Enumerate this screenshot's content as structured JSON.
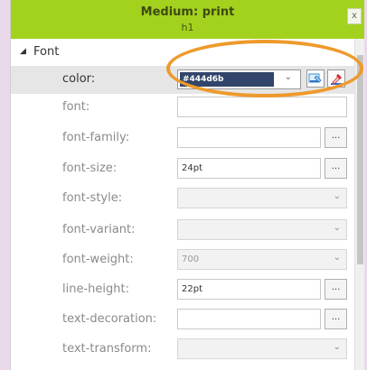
{
  "header": {
    "title": "Medium: print",
    "subtitle": "h1",
    "close_glyph": "x"
  },
  "section": {
    "label": "Font",
    "collapse_icon": "triangle-down-icon"
  },
  "properties": [
    {
      "label": "color:",
      "value": "#444d6b",
      "type": "color"
    },
    {
      "label": "font:",
      "value": "",
      "type": "text"
    },
    {
      "label": "font-family:",
      "value": "",
      "type": "text-ellipsis"
    },
    {
      "label": "font-size:",
      "value": "24pt",
      "type": "text-ellipsis"
    },
    {
      "label": "font-style:",
      "value": "",
      "type": "select"
    },
    {
      "label": "font-variant:",
      "value": "",
      "type": "select"
    },
    {
      "label": "font-weight:",
      "value": "700",
      "type": "select"
    },
    {
      "label": "line-height:",
      "value": "22pt",
      "type": "text-ellipsis"
    },
    {
      "label": "text-decoration:",
      "value": "",
      "type": "text-ellipsis"
    },
    {
      "label": "text-transform:",
      "value": "",
      "type": "select"
    }
  ],
  "ellipsis_label": "...",
  "chevron_glyph": "⌄",
  "colors": {
    "titlebar": "#a3d21e",
    "highlight_circle": "#ee9a2c",
    "color_swatch": "#31456a"
  }
}
